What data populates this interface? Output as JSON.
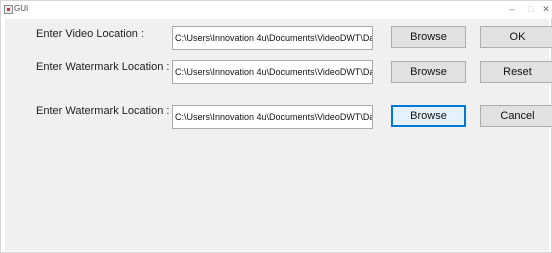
{
  "window": {
    "title": "GUI"
  },
  "form": {
    "rows": [
      {
        "label": "Enter Video Location :",
        "path": "C:\\Users\\Innovation 4u\\Documents\\VideoDWT\\Dat",
        "browse": "Browse"
      },
      {
        "label": "Enter Watermark Location :",
        "path": "C:\\Users\\Innovation 4u\\Documents\\VideoDWT\\Dat",
        "browse": "Browse"
      },
      {
        "label": "Enter Watermark Location :",
        "path": "C:\\Users\\Innovation 4u\\Documents\\VideoDWT\\Dat",
        "browse": "Browse"
      }
    ],
    "ok_label": "OK",
    "reset_label": "Reset",
    "cancel_label": "Cancel"
  }
}
